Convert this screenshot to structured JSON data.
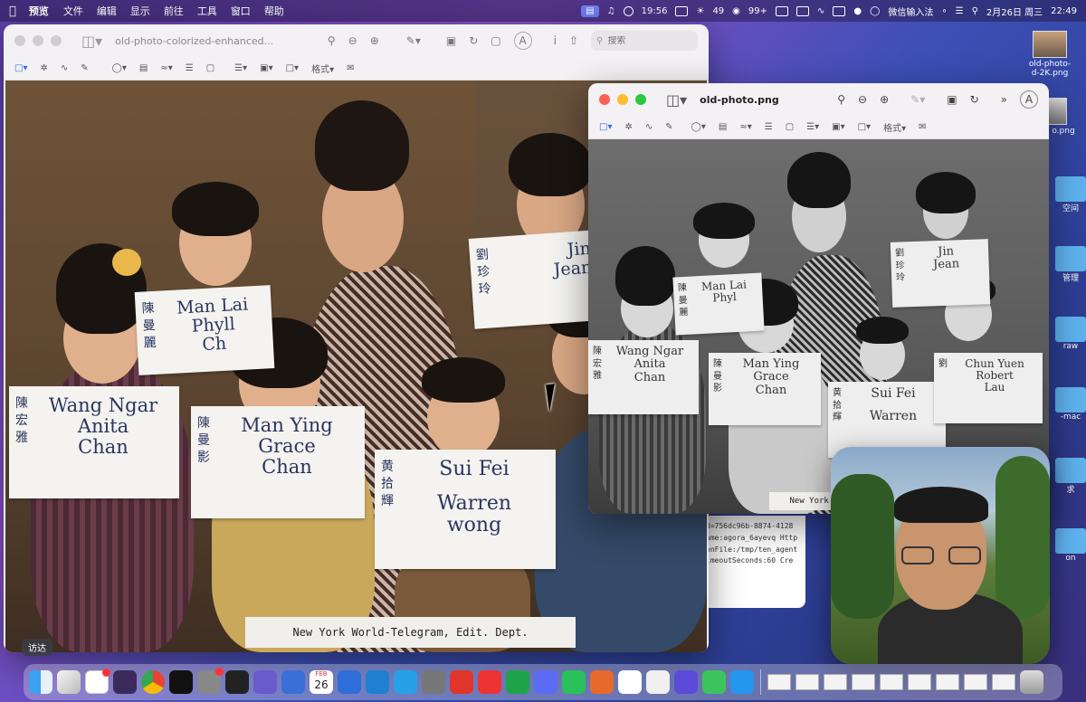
{
  "menubar": {
    "apple": "",
    "app": "预览",
    "items": [
      "文件",
      "编辑",
      "显示",
      "前往",
      "工具",
      "窗口",
      "帮助"
    ],
    "time_small": "19:56",
    "battery_pct": "49",
    "msg_count": "99+",
    "input_method": "微信输入法",
    "date": "2月26日 周三",
    "clock": "22:49"
  },
  "desktop": {
    "file1": "old-photo-\n...d-2K.png",
    "file1_label_top": "old-photo-",
    "file1_label_bottom": "d-2K.png",
    "file2_label": "o.png",
    "folder_labels": [
      "空间",
      "管理",
      "raw",
      "-mac",
      "求",
      "on"
    ]
  },
  "main_window": {
    "title": "old-photo-colorized-enhanced...",
    "search_placeholder": "搜索",
    "format_label": "格式",
    "signs": [
      {
        "zh": "陳宏雅",
        "en": [
          "Wang Ngar",
          "Anita",
          "Chan"
        ]
      },
      {
        "zh": "陳曼影",
        "en": [
          "Man Ying",
          "Grace",
          "Chan"
        ]
      },
      {
        "zh": "黄拾輝",
        "en": [
          "Sui Fei",
          "Warren",
          "wong"
        ]
      },
      {
        "zh": "陳曼麗",
        "en": [
          "Man Lai",
          "Phyll",
          "Ch"
        ]
      },
      {
        "zh": "劉珍玲",
        "en": [
          "Jin",
          "Jean"
        ]
      }
    ],
    "caption": "New York World-Telegram, Edit. Dept."
  },
  "second_window": {
    "title": "old-photo.png",
    "format_label": "格式",
    "signs": [
      {
        "zh": "陳宏雅",
        "en": [
          "Wang Ngar",
          "Anita",
          "Chan"
        ]
      },
      {
        "zh": "陳曼影",
        "en": [
          "Man Ying",
          "Grace",
          "Chan"
        ]
      },
      {
        "zh": "黄拾輝",
        "en": [
          "Sui Fei",
          "Warren"
        ]
      },
      {
        "zh": "劉",
        "en": [
          "Chun Yuen",
          "Robert",
          "Lau"
        ]
      },
      {
        "zh": "陳曼麗",
        "en": [
          "Man Lai",
          "Phyl"
        ]
      },
      {
        "zh": "劉珍玲",
        "en": [
          "Jin",
          "Jean"
        ]
      }
    ],
    "caption": "New York Wor"
  },
  "terminal": {
    "lines": [
      "d=756dc96b-8874-4128",
      "",
      "ame:agora_6ayevq Http",
      "onFile:/tmp/ten_agent",
      "imeoutSeconds:60 Cre"
    ]
  },
  "dock": {
    "tooltip": "访达",
    "calendar_month": "FEB",
    "calendar_day": "26"
  },
  "colors": {
    "accent": "#6d7cf2",
    "close": "#fe5f57",
    "minimize": "#febc2e",
    "zoom": "#28c840"
  }
}
